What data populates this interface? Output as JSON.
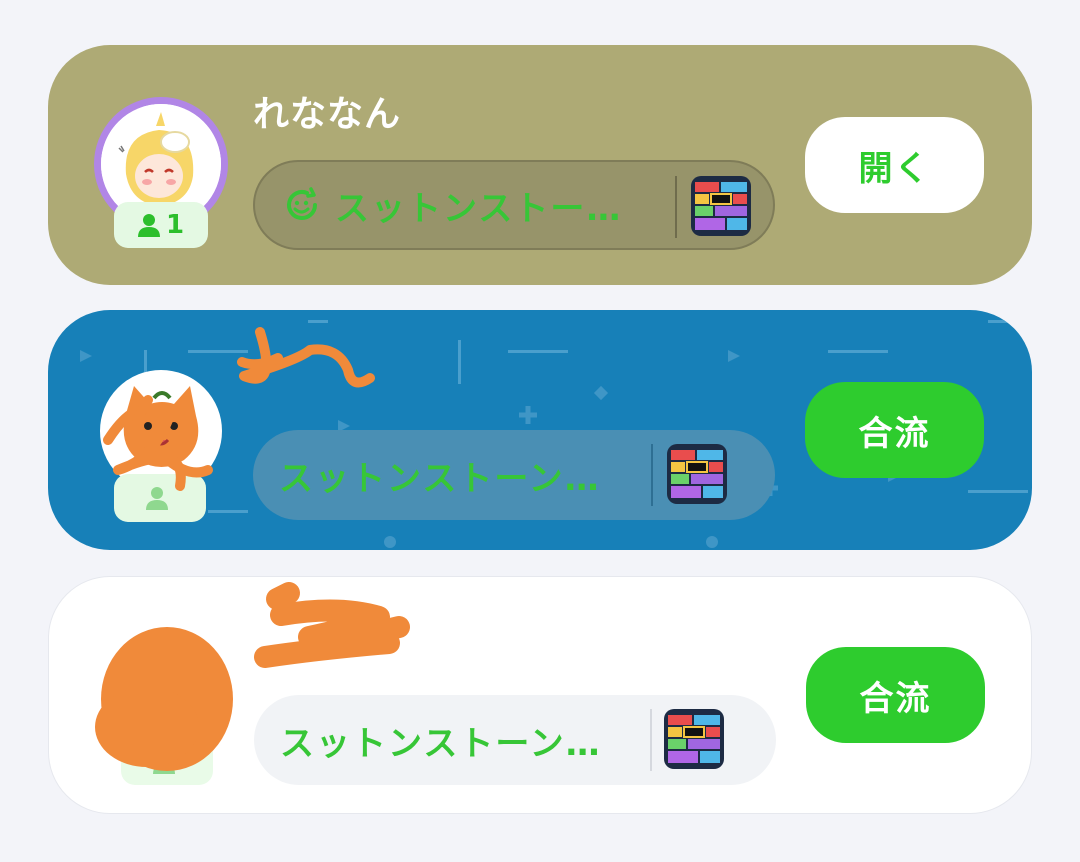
{
  "cards": [
    {
      "username": "れななん",
      "member_count": "1",
      "game_title": "スットンストー…",
      "action_label": "開く",
      "bg_color": "#aeaa75"
    },
    {
      "username": "",
      "member_count": "",
      "game_title": "スットンストーン…",
      "action_label": "合流",
      "bg_color": "#1780b8"
    },
    {
      "username": "",
      "member_count": "",
      "game_title": "スットンストーン…",
      "action_label": "合流",
      "bg_color": "#ffffff"
    }
  ],
  "colors": {
    "accent_green": "#2ecc2e",
    "badge_bg": "#e4f9e3",
    "page_bg": "#f3f4f9"
  },
  "icons": {
    "member": "person-icon",
    "activity": "smile-arrow-icon",
    "game": "block-stack-game-icon"
  }
}
